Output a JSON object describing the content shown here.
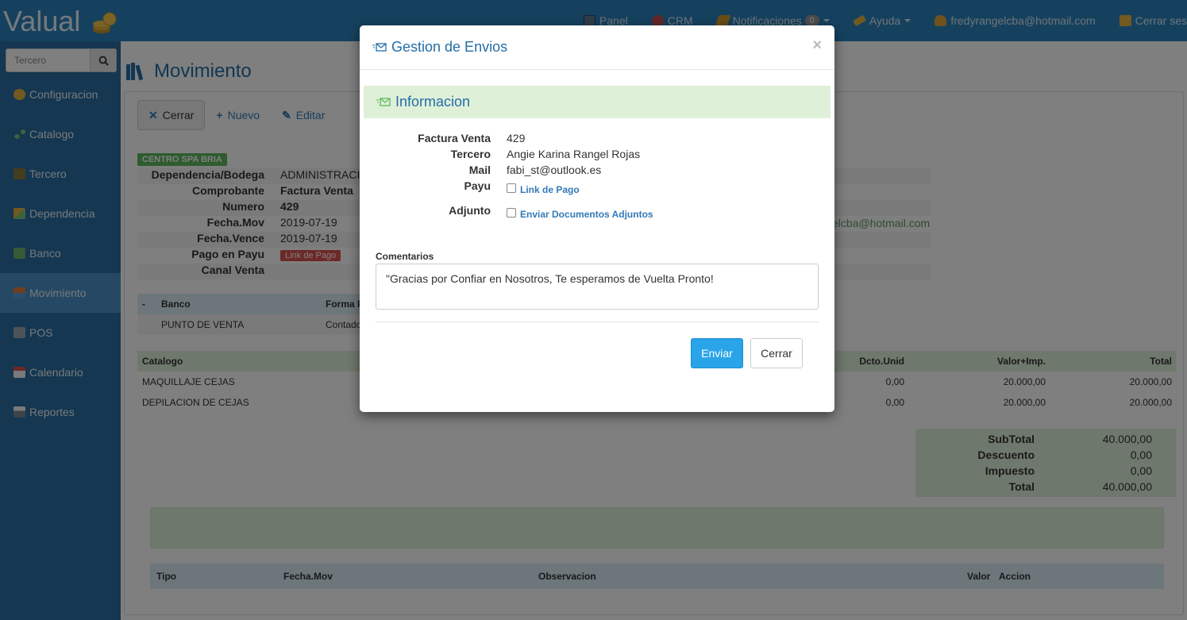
{
  "app": {
    "logo": "Valual",
    "colors": {
      "navbar": "#2b82bd",
      "sidebar": "#2a6fa2",
      "accent": "#236ea7",
      "success_bg": "#dff0d8"
    }
  },
  "navbar": {
    "panel": "Panel",
    "crm": "CRM",
    "notifications": "Notificaciones",
    "notifications_count": "0",
    "help": "Ayuda",
    "user": "fredyrangelcba@hotmail.com",
    "logout": "Cerrar ses"
  },
  "sidebar": {
    "search_placeholder": "Tercero",
    "items": [
      {
        "label": "Configuracion",
        "icon": "gear-icon"
      },
      {
        "label": "Catalogo",
        "icon": "nodes-icon"
      },
      {
        "label": "Tercero",
        "icon": "person-icon"
      },
      {
        "label": "Dependencia",
        "icon": "building-icon"
      },
      {
        "label": "Banco",
        "icon": "money-icon"
      },
      {
        "label": "Movimiento",
        "icon": "boxes-icon"
      },
      {
        "label": "POS",
        "icon": "cart-icon"
      },
      {
        "label": "Calendario",
        "icon": "calendar-icon"
      },
      {
        "label": "Reportes",
        "icon": "printer-icon"
      }
    ]
  },
  "main": {
    "title": "Movimiento",
    "toolbar": {
      "cerrar": "Cerrar",
      "nuevo": "Nuevo",
      "editar": "Editar"
    },
    "spa_label": "CENTRO SPA BRIA",
    "fields": [
      {
        "k": "Dependencia/Bodega",
        "v": "ADMINISTRACI"
      },
      {
        "k": "Comprobante",
        "v": "Factura Venta"
      },
      {
        "k": "Numero",
        "v": "429"
      },
      {
        "k": "Fecha.Mov",
        "v": "2019-07-19"
      },
      {
        "k": "Fecha.Vence",
        "v": "2019-07-19"
      },
      {
        "k": "Pago en Payu",
        "v": "Link de Pago"
      },
      {
        "k": "Canal Venta",
        "v": ""
      }
    ],
    "right_mail": "elcba@hotmail.com",
    "bank_table": {
      "headers": [
        "-",
        "Banco",
        "Forma P"
      ],
      "rows": [
        [
          "",
          "PUNTO DE VENTA",
          "Contado"
        ]
      ]
    },
    "catalog_table": {
      "headers": [
        "Catalogo",
        "Dcto.Unid",
        "Valor+Imp.",
        "Total"
      ],
      "rows": [
        [
          "MAQUILLAJE CEJAS",
          "0,00",
          "20.000,00",
          "20.000,00"
        ],
        [
          "DEPILACION DE CEJAS",
          "0,00",
          "20.000,00",
          "20.000,00"
        ]
      ]
    },
    "totals": [
      {
        "k": "SubTotal",
        "v": "40.000,00"
      },
      {
        "k": "Descuento",
        "v": "0,00"
      },
      {
        "k": "Impuesto",
        "v": "0,00"
      },
      {
        "k": "Total",
        "v": "40.000,00"
      }
    ],
    "mov_table": {
      "headers": [
        "Tipo",
        "Fecha.Mov",
        "Observacion",
        "Valor",
        "Accion"
      ]
    }
  },
  "modal": {
    "title": "Gestion de Envios",
    "close": "×",
    "section": "Informacion",
    "factura_label": "Factura Venta",
    "factura_value": "429",
    "tercero_label": "Tercero",
    "tercero_value": "Angie Karina Rangel Rojas",
    "mail_label": "Mail",
    "mail_value": "fabi_st@outlook.es",
    "payu_label": "Payu",
    "payu_option": "Link de Pago",
    "adjunto_label": "Adjunto",
    "adjunto_option": "Enviar Documentos Adjuntos",
    "comments_label": "Comentarios",
    "comments_value": "\"Gracias por Confiar en Nosotros, Te esperamos de Vuelta Pronto!",
    "send": "Enviar",
    "cancel": "Cerrar"
  }
}
